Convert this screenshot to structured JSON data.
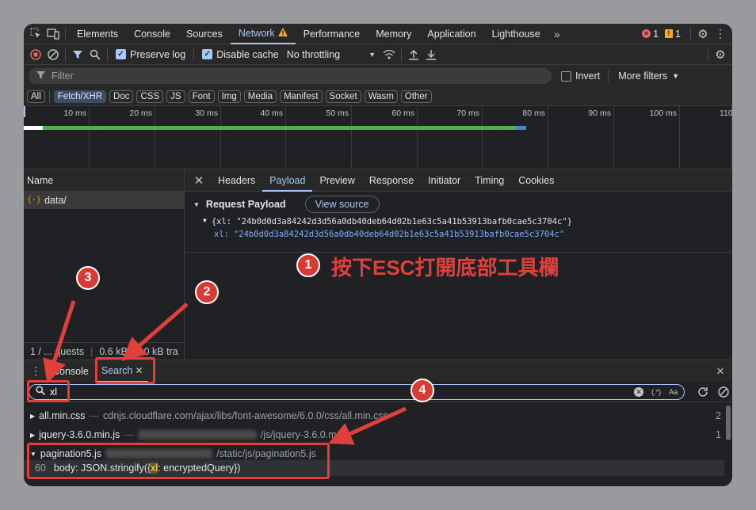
{
  "tabs": [
    "Elements",
    "Console",
    "Sources",
    "Network",
    "Performance",
    "Memory",
    "Application",
    "Lighthouse"
  ],
  "active_tab": "Network",
  "more_tabs_glyph": "»",
  "errors": {
    "error_count": "1",
    "warning_count": "1"
  },
  "toolbar": {
    "preserve_log": "Preserve log",
    "disable_cache": "Disable cache",
    "throttling": "No throttling"
  },
  "filter": {
    "placeholder": "Filter",
    "invert": "Invert",
    "more_filters": "More filters"
  },
  "types": [
    "All",
    "Fetch/XHR",
    "Doc",
    "CSS",
    "JS",
    "Font",
    "Img",
    "Media",
    "Manifest",
    "Socket",
    "Wasm",
    "Other"
  ],
  "active_type": "Fetch/XHR",
  "timeline": {
    "ticks": [
      "10 ms",
      "20 ms",
      "30 ms",
      "40 ms",
      "50 ms",
      "60 ms",
      "70 ms",
      "80 ms",
      "90 ms",
      "100 ms",
      "110"
    ]
  },
  "requests": {
    "header": "Name",
    "items": [
      {
        "name": "data/"
      }
    ],
    "count_text": "1 / ... quests",
    "size_text": "0.6 kB / 2.0 kB tra"
  },
  "detail": {
    "tabs": [
      "Headers",
      "Payload",
      "Preview",
      "Response",
      "Initiator",
      "Timing",
      "Cookies"
    ],
    "active_tab": "Payload",
    "section_title": "Request Payload",
    "view_source": "View source",
    "payload_summary": "{xl: \"24b0d0d3a84242d3d56a0db40deb64d02b1e63c5a41b53913bafb0cae5c3704c\"}",
    "payload_key": "xl:",
    "payload_value": "\"24b0d0d3a84242d3d56a0db40deb64d02b1e63c5a41b53913bafb0cae5c3704c\""
  },
  "drawer": {
    "console": "Console",
    "search": "Search",
    "close": "×"
  },
  "search": {
    "value": "xl",
    "regex": "(.*)",
    "case": "Aa"
  },
  "results": [
    {
      "file": "all.min.css",
      "path": "cdnjs.cloudflare.com/ajax/libs/font-awesome/6.0.0/css/all.min.css",
      "count": "2"
    },
    {
      "file": "jquery-3.6.0.min.js",
      "path": "/js/jquery-3.6.0.m...",
      "count": "1"
    },
    {
      "file": "pagination5.js",
      "path": "/static/js/pagination5.js",
      "count": ""
    }
  ],
  "match": {
    "line": "60",
    "pre": "body: JSON.stringify({",
    "hit": "xl",
    "post": ": encryptedQuery})"
  },
  "annotations": {
    "step1_number": "1",
    "step1_text": "按下ESC打開底部工具欄",
    "step2_number": "2",
    "step3_number": "3",
    "step4_number": "4"
  },
  "colors": {
    "accent": "#a8c7fa",
    "annotation_red": "#e0403a",
    "badge_red": "#d93a33",
    "timeline_green": "#4caf50"
  }
}
